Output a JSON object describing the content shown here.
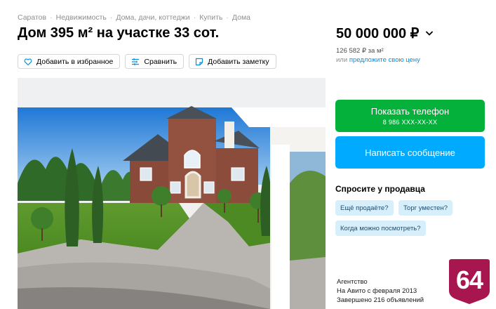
{
  "breadcrumbs": [
    "Саратов",
    "Недвижимость",
    "Дома, дачи, коттеджи",
    "Купить",
    "Дома"
  ],
  "title": "Дом 395 м² на участке 33 сот.",
  "actions": {
    "favorite": "Добавить в избранное",
    "compare": "Сравнить",
    "note": "Добавить заметку"
  },
  "price": {
    "value": "50 000 000 ₽",
    "per_meter": "126 582 ₽ за м²",
    "or": "или",
    "offer_link": "предложите свою цену"
  },
  "contact": {
    "phone_label": "Показать телефон",
    "phone_number": "8 986 XXX-XX-XX",
    "message_label": "Написать сообщение"
  },
  "ask": {
    "title": "Спросите у продавца",
    "chips": [
      "Ещё продаёте?",
      "Торг уместен?",
      "Когда можно посмотреть?"
    ]
  },
  "seller": {
    "type": "Агентство",
    "since": "На Авито с февраля 2013",
    "completed": "Завершено 216 объявлений"
  },
  "badge": {
    "text": "64",
    "color": "#a8164f"
  },
  "colors": {
    "green": "#04b23b",
    "blue": "#00aaff",
    "link": "#0a8de0",
    "chip_bg": "#d7eefb"
  },
  "icons": {
    "favorite": "heart-icon",
    "compare": "compare-icon",
    "note": "note-icon",
    "price_toggle": "chevron-down-icon"
  }
}
